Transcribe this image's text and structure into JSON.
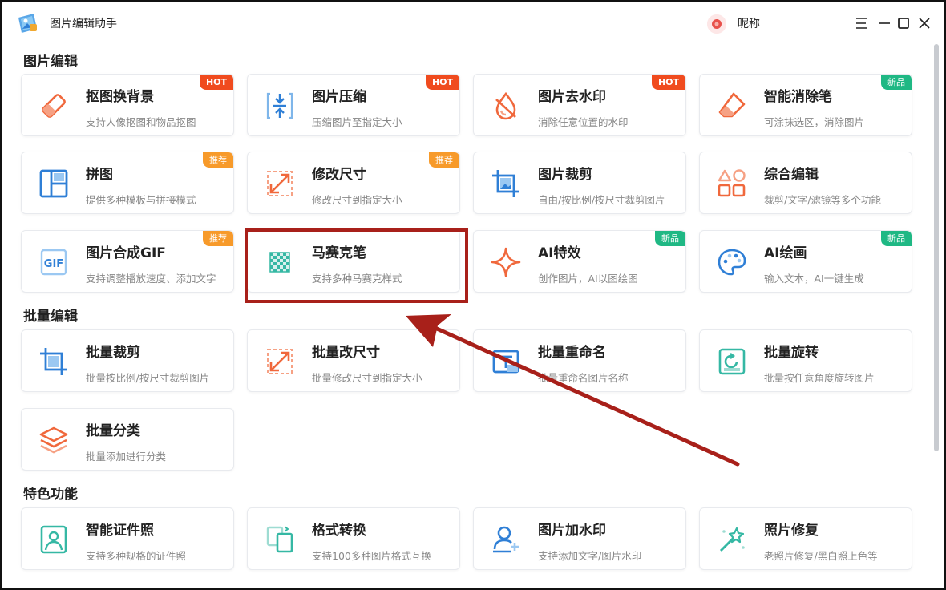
{
  "app": {
    "title": "图片编辑助手",
    "nickname": "昵称"
  },
  "colors": {
    "hot": "#f04b1e",
    "recommend": "#f79a2a",
    "new": "#1fb884",
    "annotation": "#a8201a",
    "icon_orange": "#f0683c",
    "icon_blue": "#2f7fd6",
    "icon_teal": "#35b8a4"
  },
  "sections": [
    {
      "title": "图片编辑"
    },
    {
      "title": "批量编辑"
    },
    {
      "title": "特色功能"
    }
  ],
  "cards": [
    {
      "title": "抠图换背景",
      "desc": "支持人像抠图和物品抠图",
      "badge": "HOT",
      "icon": "eraser-icon"
    },
    {
      "title": "图片压缩",
      "desc": "压缩图片至指定大小",
      "badge": "HOT",
      "icon": "compress-icon"
    },
    {
      "title": "图片去水印",
      "desc": "消除任意位置的水印",
      "badge": "HOT",
      "icon": "drop-slash-icon"
    },
    {
      "title": "智能消除笔",
      "desc": "可涂抹选区，消除图片",
      "badge": "新品",
      "icon": "erase-pen-icon"
    },
    {
      "title": "拼图",
      "desc": "提供多种模板与拼接模式",
      "badge": "推荐",
      "icon": "collage-icon"
    },
    {
      "title": "修改尺寸",
      "desc": "修改尺寸到指定大小",
      "badge": "推荐",
      "icon": "resize-icon"
    },
    {
      "title": "图片裁剪",
      "desc": "自由/按比例/按尺寸裁剪图片",
      "badge": "",
      "icon": "crop-icon"
    },
    {
      "title": "综合编辑",
      "desc": "裁剪/文字/滤镜等多个功能",
      "badge": "",
      "icon": "shapes-icon"
    },
    {
      "title": "图片合成GIF",
      "desc": "支持调整播放速度、添加文字",
      "badge": "推荐",
      "icon": "gif-icon"
    },
    {
      "title": "马赛克笔",
      "desc": "支持多种马赛克样式",
      "badge": "",
      "icon": "mosaic-icon"
    },
    {
      "title": "AI特效",
      "desc": "创作图片，AI以图绘图",
      "badge": "新品",
      "icon": "sparkle-icon"
    },
    {
      "title": "AI绘画",
      "desc": "输入文本，AI一键生成",
      "badge": "新品",
      "icon": "palette-icon"
    },
    {
      "title": "批量裁剪",
      "desc": "批量按比例/按尺寸裁剪图片",
      "badge": "",
      "icon": "batch-crop-icon"
    },
    {
      "title": "批量改尺寸",
      "desc": "批量修改尺寸到指定大小",
      "badge": "",
      "icon": "batch-resize-icon"
    },
    {
      "title": "批量重命名",
      "desc": "批量重命名图片名称",
      "badge": "",
      "icon": "rename-icon"
    },
    {
      "title": "批量旋转",
      "desc": "批量按任意角度旋转图片",
      "badge": "",
      "icon": "rotate-icon"
    },
    {
      "title": "批量分类",
      "desc": "批量添加进行分类",
      "badge": "",
      "icon": "layers-icon"
    },
    {
      "title": "智能证件照",
      "desc": "支持多种规格的证件照",
      "badge": "",
      "icon": "id-photo-icon"
    },
    {
      "title": "格式转换",
      "desc": "支持100多种图片格式互换",
      "badge": "",
      "icon": "convert-icon"
    },
    {
      "title": "图片加水印",
      "desc": "支持添加文字/图片水印",
      "badge": "",
      "icon": "watermark-icon"
    },
    {
      "title": "照片修复",
      "desc": "老照片修复/黑白照上色等",
      "badge": "",
      "icon": "magic-wand-icon"
    }
  ]
}
